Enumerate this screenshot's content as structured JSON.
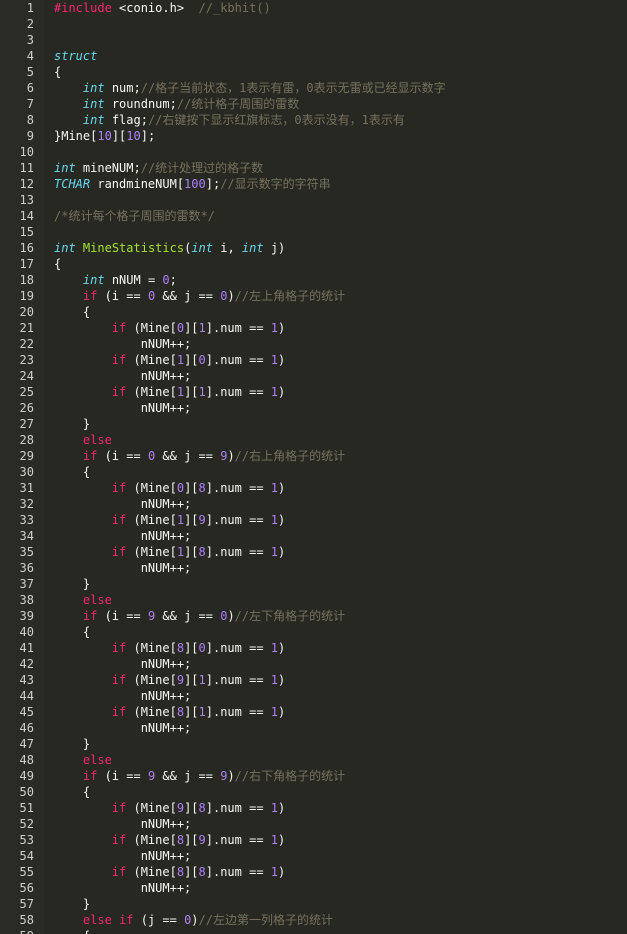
{
  "editor": {
    "colors": {
      "background": "#272822",
      "keyword": "#f92672",
      "type": "#66d9ef",
      "function": "#a6e22e",
      "number": "#ae81ff",
      "comment": "#75715e",
      "string": "#e6db74",
      "text": "#f8f8f2"
    },
    "lines": [
      {
        "n": "1",
        "t": [
          [
            "kw",
            "#include "
          ],
          [
            "plain",
            "<conio.h>"
          ],
          [
            "plain",
            "  "
          ],
          [
            "cmt",
            "//_kbhit()"
          ]
        ]
      },
      {
        "n": "2",
        "t": []
      },
      {
        "n": "3",
        "t": []
      },
      {
        "n": "4",
        "t": [
          [
            "type",
            "struct"
          ]
        ]
      },
      {
        "n": "5",
        "t": [
          [
            "plain",
            "{"
          ]
        ]
      },
      {
        "n": "6",
        "t": [
          [
            "plain",
            "    "
          ],
          [
            "type",
            "int"
          ],
          [
            "plain",
            " num;"
          ],
          [
            "cmt",
            "//格子当前状态，1表示有雷，0表示无雷或已经显示数字"
          ]
        ]
      },
      {
        "n": "7",
        "t": [
          [
            "plain",
            "    "
          ],
          [
            "type",
            "int"
          ],
          [
            "plain",
            " roundnum;"
          ],
          [
            "cmt",
            "//统计格子周围的雷数"
          ]
        ]
      },
      {
        "n": "8",
        "t": [
          [
            "plain",
            "    "
          ],
          [
            "type",
            "int"
          ],
          [
            "plain",
            " flag;"
          ],
          [
            "cmt",
            "//右键按下显示红旗标志，0表示没有，1表示有"
          ]
        ]
      },
      {
        "n": "9",
        "t": [
          [
            "plain",
            "}Mine["
          ],
          [
            "num",
            "10"
          ],
          [
            "plain",
            "]["
          ],
          [
            "num",
            "10"
          ],
          [
            "plain",
            "];"
          ]
        ]
      },
      {
        "n": "10",
        "t": []
      },
      {
        "n": "11",
        "t": [
          [
            "type",
            "int"
          ],
          [
            "plain",
            " mineNUM;"
          ],
          [
            "cmt",
            "//统计处理过的格子数"
          ]
        ]
      },
      {
        "n": "12",
        "t": [
          [
            "type",
            "TCHAR"
          ],
          [
            "plain",
            " randmineNUM["
          ],
          [
            "num",
            "100"
          ],
          [
            "plain",
            "];"
          ],
          [
            "cmt",
            "//显示数字的字符串"
          ]
        ]
      },
      {
        "n": "13",
        "t": []
      },
      {
        "n": "14",
        "t": [
          [
            "cmt",
            "/*统计每个格子周围的雷数*/"
          ]
        ]
      },
      {
        "n": "15",
        "t": []
      },
      {
        "n": "16",
        "t": [
          [
            "type",
            "int"
          ],
          [
            "plain",
            " "
          ],
          [
            "fn",
            "MineStatistics"
          ],
          [
            "plain",
            "("
          ],
          [
            "type",
            "int"
          ],
          [
            "plain",
            " i, "
          ],
          [
            "type",
            "int"
          ],
          [
            "plain",
            " j)"
          ]
        ]
      },
      {
        "n": "17",
        "t": [
          [
            "plain",
            "{"
          ]
        ]
      },
      {
        "n": "18",
        "t": [
          [
            "plain",
            "    "
          ],
          [
            "type",
            "int"
          ],
          [
            "plain",
            " nNUM = "
          ],
          [
            "num",
            "0"
          ],
          [
            "plain",
            ";"
          ]
        ]
      },
      {
        "n": "19",
        "t": [
          [
            "plain",
            "    "
          ],
          [
            "kw",
            "if"
          ],
          [
            "plain",
            " (i == "
          ],
          [
            "num",
            "0"
          ],
          [
            "plain",
            " && j == "
          ],
          [
            "num",
            "0"
          ],
          [
            "plain",
            ")"
          ],
          [
            "cmt",
            "//左上角格子的统计"
          ]
        ]
      },
      {
        "n": "20",
        "t": [
          [
            "plain",
            "    {"
          ]
        ]
      },
      {
        "n": "21",
        "t": [
          [
            "plain",
            "        "
          ],
          [
            "kw",
            "if"
          ],
          [
            "plain",
            " (Mine["
          ],
          [
            "num",
            "0"
          ],
          [
            "plain",
            "]["
          ],
          [
            "num",
            "1"
          ],
          [
            "plain",
            "].num == "
          ],
          [
            "num",
            "1"
          ],
          [
            "plain",
            ")"
          ]
        ]
      },
      {
        "n": "22",
        "t": [
          [
            "plain",
            "            nNUM++;"
          ]
        ]
      },
      {
        "n": "23",
        "t": [
          [
            "plain",
            "        "
          ],
          [
            "kw",
            "if"
          ],
          [
            "plain",
            " (Mine["
          ],
          [
            "num",
            "1"
          ],
          [
            "plain",
            "]["
          ],
          [
            "num",
            "0"
          ],
          [
            "plain",
            "].num == "
          ],
          [
            "num",
            "1"
          ],
          [
            "plain",
            ")"
          ]
        ]
      },
      {
        "n": "24",
        "t": [
          [
            "plain",
            "            nNUM++;"
          ]
        ]
      },
      {
        "n": "25",
        "t": [
          [
            "plain",
            "        "
          ],
          [
            "kw",
            "if"
          ],
          [
            "plain",
            " (Mine["
          ],
          [
            "num",
            "1"
          ],
          [
            "plain",
            "]["
          ],
          [
            "num",
            "1"
          ],
          [
            "plain",
            "].num == "
          ],
          [
            "num",
            "1"
          ],
          [
            "plain",
            ")"
          ]
        ]
      },
      {
        "n": "26",
        "t": [
          [
            "plain",
            "            nNUM++;"
          ]
        ]
      },
      {
        "n": "27",
        "t": [
          [
            "plain",
            "    }"
          ]
        ]
      },
      {
        "n": "28",
        "t": [
          [
            "plain",
            "    "
          ],
          [
            "kw",
            "else"
          ]
        ]
      },
      {
        "n": "29",
        "t": [
          [
            "plain",
            "    "
          ],
          [
            "kw",
            "if"
          ],
          [
            "plain",
            " (i == "
          ],
          [
            "num",
            "0"
          ],
          [
            "plain",
            " && j == "
          ],
          [
            "num",
            "9"
          ],
          [
            "plain",
            ")"
          ],
          [
            "cmt",
            "//右上角格子的统计"
          ]
        ]
      },
      {
        "n": "30",
        "t": [
          [
            "plain",
            "    {"
          ]
        ]
      },
      {
        "n": "31",
        "t": [
          [
            "plain",
            "        "
          ],
          [
            "kw",
            "if"
          ],
          [
            "plain",
            " (Mine["
          ],
          [
            "num",
            "0"
          ],
          [
            "plain",
            "]["
          ],
          [
            "num",
            "8"
          ],
          [
            "plain",
            "].num == "
          ],
          [
            "num",
            "1"
          ],
          [
            "plain",
            ")"
          ]
        ]
      },
      {
        "n": "32",
        "t": [
          [
            "plain",
            "            nNUM++;"
          ]
        ]
      },
      {
        "n": "33",
        "t": [
          [
            "plain",
            "        "
          ],
          [
            "kw",
            "if"
          ],
          [
            "plain",
            " (Mine["
          ],
          [
            "num",
            "1"
          ],
          [
            "plain",
            "]["
          ],
          [
            "num",
            "9"
          ],
          [
            "plain",
            "].num == "
          ],
          [
            "num",
            "1"
          ],
          [
            "plain",
            ")"
          ]
        ]
      },
      {
        "n": "34",
        "t": [
          [
            "plain",
            "            nNUM++;"
          ]
        ]
      },
      {
        "n": "35",
        "t": [
          [
            "plain",
            "        "
          ],
          [
            "kw",
            "if"
          ],
          [
            "plain",
            " (Mine["
          ],
          [
            "num",
            "1"
          ],
          [
            "plain",
            "]["
          ],
          [
            "num",
            "8"
          ],
          [
            "plain",
            "].num == "
          ],
          [
            "num",
            "1"
          ],
          [
            "plain",
            ")"
          ]
        ]
      },
      {
        "n": "36",
        "t": [
          [
            "plain",
            "            nNUM++;"
          ]
        ]
      },
      {
        "n": "37",
        "t": [
          [
            "plain",
            "    }"
          ]
        ]
      },
      {
        "n": "38",
        "t": [
          [
            "plain",
            "    "
          ],
          [
            "kw",
            "else"
          ]
        ]
      },
      {
        "n": "39",
        "t": [
          [
            "plain",
            "    "
          ],
          [
            "kw",
            "if"
          ],
          [
            "plain",
            " (i == "
          ],
          [
            "num",
            "9"
          ],
          [
            "plain",
            " && j == "
          ],
          [
            "num",
            "0"
          ],
          [
            "plain",
            ")"
          ],
          [
            "cmt",
            "//左下角格子的统计"
          ]
        ]
      },
      {
        "n": "40",
        "t": [
          [
            "plain",
            "    {"
          ]
        ]
      },
      {
        "n": "41",
        "t": [
          [
            "plain",
            "        "
          ],
          [
            "kw",
            "if"
          ],
          [
            "plain",
            " (Mine["
          ],
          [
            "num",
            "8"
          ],
          [
            "plain",
            "]["
          ],
          [
            "num",
            "0"
          ],
          [
            "plain",
            "].num == "
          ],
          [
            "num",
            "1"
          ],
          [
            "plain",
            ")"
          ]
        ]
      },
      {
        "n": "42",
        "t": [
          [
            "plain",
            "            nNUM++;"
          ]
        ]
      },
      {
        "n": "43",
        "t": [
          [
            "plain",
            "        "
          ],
          [
            "kw",
            "if"
          ],
          [
            "plain",
            " (Mine["
          ],
          [
            "num",
            "9"
          ],
          [
            "plain",
            "]["
          ],
          [
            "num",
            "1"
          ],
          [
            "plain",
            "].num == "
          ],
          [
            "num",
            "1"
          ],
          [
            "plain",
            ")"
          ]
        ]
      },
      {
        "n": "44",
        "t": [
          [
            "plain",
            "            nNUM++;"
          ]
        ]
      },
      {
        "n": "45",
        "t": [
          [
            "plain",
            "        "
          ],
          [
            "kw",
            "if"
          ],
          [
            "plain",
            " (Mine["
          ],
          [
            "num",
            "8"
          ],
          [
            "plain",
            "]["
          ],
          [
            "num",
            "1"
          ],
          [
            "plain",
            "].num == "
          ],
          [
            "num",
            "1"
          ],
          [
            "plain",
            ")"
          ]
        ]
      },
      {
        "n": "46",
        "t": [
          [
            "plain",
            "            nNUM++;"
          ]
        ]
      },
      {
        "n": "47",
        "t": [
          [
            "plain",
            "    }"
          ]
        ]
      },
      {
        "n": "48",
        "t": [
          [
            "plain",
            "    "
          ],
          [
            "kw",
            "else"
          ]
        ]
      },
      {
        "n": "49",
        "t": [
          [
            "plain",
            "    "
          ],
          [
            "kw",
            "if"
          ],
          [
            "plain",
            " (i == "
          ],
          [
            "num",
            "9"
          ],
          [
            "plain",
            " && j == "
          ],
          [
            "num",
            "9"
          ],
          [
            "plain",
            ")"
          ],
          [
            "cmt",
            "//右下角格子的统计"
          ]
        ]
      },
      {
        "n": "50",
        "t": [
          [
            "plain",
            "    {"
          ]
        ]
      },
      {
        "n": "51",
        "t": [
          [
            "plain",
            "        "
          ],
          [
            "kw",
            "if"
          ],
          [
            "plain",
            " (Mine["
          ],
          [
            "num",
            "9"
          ],
          [
            "plain",
            "]["
          ],
          [
            "num",
            "8"
          ],
          [
            "plain",
            "].num == "
          ],
          [
            "num",
            "1"
          ],
          [
            "plain",
            ")"
          ]
        ]
      },
      {
        "n": "52",
        "t": [
          [
            "plain",
            "            nNUM++;"
          ]
        ]
      },
      {
        "n": "53",
        "t": [
          [
            "plain",
            "        "
          ],
          [
            "kw",
            "if"
          ],
          [
            "plain",
            " (Mine["
          ],
          [
            "num",
            "8"
          ],
          [
            "plain",
            "]["
          ],
          [
            "num",
            "9"
          ],
          [
            "plain",
            "].num == "
          ],
          [
            "num",
            "1"
          ],
          [
            "plain",
            ")"
          ]
        ]
      },
      {
        "n": "54",
        "t": [
          [
            "plain",
            "            nNUM++;"
          ]
        ]
      },
      {
        "n": "55",
        "t": [
          [
            "plain",
            "        "
          ],
          [
            "kw",
            "if"
          ],
          [
            "plain",
            " (Mine["
          ],
          [
            "num",
            "8"
          ],
          [
            "plain",
            "]["
          ],
          [
            "num",
            "8"
          ],
          [
            "plain",
            "].num == "
          ],
          [
            "num",
            "1"
          ],
          [
            "plain",
            ")"
          ]
        ]
      },
      {
        "n": "56",
        "t": [
          [
            "plain",
            "            nNUM++;"
          ]
        ]
      },
      {
        "n": "57",
        "t": [
          [
            "plain",
            "    }"
          ]
        ]
      },
      {
        "n": "58",
        "t": [
          [
            "plain",
            "    "
          ],
          [
            "kw",
            "else if"
          ],
          [
            "plain",
            " (j == "
          ],
          [
            "num",
            "0"
          ],
          [
            "plain",
            ")"
          ],
          [
            "cmt",
            "//左边第一列格子的统计"
          ]
        ]
      },
      {
        "n": "59",
        "t": [
          [
            "plain",
            "    {"
          ]
        ]
      }
    ]
  }
}
